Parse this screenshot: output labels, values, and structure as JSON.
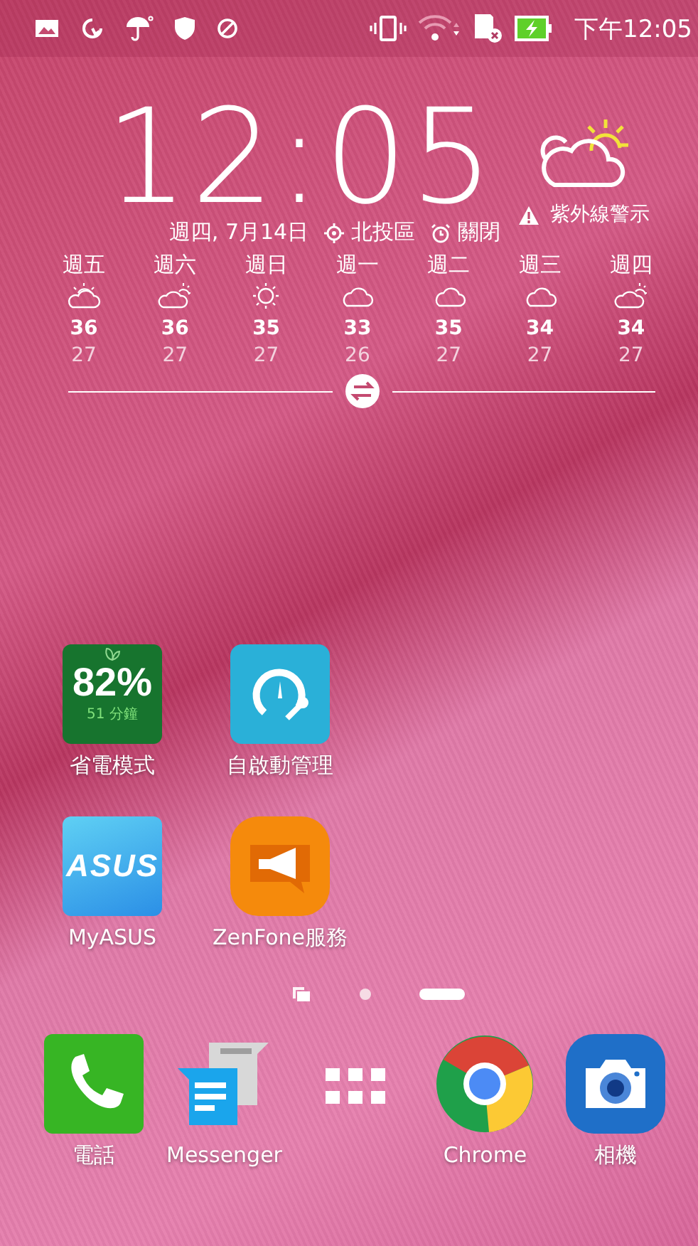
{
  "status_bar": {
    "time": "下午12:05"
  },
  "clock": {
    "time": "12:05",
    "alert": "紫外線警示",
    "date": "週四, 7月14日",
    "location": "北投區",
    "alarm": "關閉"
  },
  "forecast": [
    {
      "day": "週五",
      "kind": "sun_behind_cloud",
      "high": "36",
      "low": "27"
    },
    {
      "day": "週六",
      "kind": "cloud_sun",
      "high": "36",
      "low": "27"
    },
    {
      "day": "週日",
      "kind": "sunny",
      "high": "35",
      "low": "27"
    },
    {
      "day": "週一",
      "kind": "cloudy",
      "high": "33",
      "low": "26"
    },
    {
      "day": "週二",
      "kind": "cloudy",
      "high": "35",
      "low": "27"
    },
    {
      "day": "週三",
      "kind": "cloudy",
      "high": "34",
      "low": "27"
    },
    {
      "day": "週四",
      "kind": "cloud_sun",
      "high": "34",
      "low": "27"
    }
  ],
  "apps": [
    {
      "kind": "power_saver",
      "label": "省電模式",
      "percent": "82%",
      "remaining": "51 分鐘"
    },
    {
      "kind": "auto_start",
      "label": "自啟動管理"
    },
    {
      "kind": "asus",
      "label": "MyASUS",
      "logo": "ASUS"
    },
    {
      "kind": "service",
      "label": "ZenFone服務"
    }
  ],
  "pages": [
    {
      "kind": "home",
      "selected": false
    },
    {
      "kind": "dot",
      "selected": false
    },
    {
      "kind": "dot",
      "selected": true
    }
  ],
  "dock": [
    {
      "kind": "phone",
      "label": "電話"
    },
    {
      "kind": "messenger",
      "label": "Messenger"
    },
    {
      "kind": "drawer"
    },
    {
      "kind": "chrome",
      "label": "Chrome"
    },
    {
      "kind": "camera",
      "label": "相機"
    }
  ]
}
